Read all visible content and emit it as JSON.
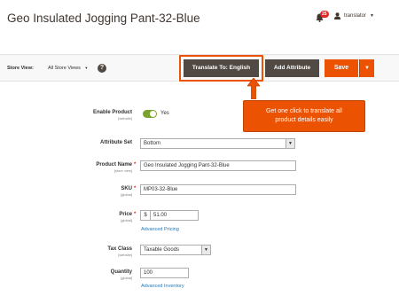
{
  "header": {
    "title": "Geo Insulated Jogging Pant-32-Blue",
    "notification_count": "25",
    "user_name": "translator",
    "icons": [
      "bell-icon",
      "user-icon",
      "caret-down-icon"
    ]
  },
  "action_bar": {
    "store_view_label": "Store View:",
    "store_view_value": "All Store Views",
    "help_label": "?",
    "translate_label": "Translate To: English",
    "add_attribute_label": "Add Attribute",
    "save_label": "Save",
    "save_split_label": "▼"
  },
  "callout": {
    "line1": "Get one click to translate all",
    "line2": "product details easily"
  },
  "form": {
    "enable_product": {
      "label": "Enable Product",
      "scope": "[website]",
      "value": "Yes",
      "checked": true
    },
    "attribute_set": {
      "label": "Attribute Set",
      "value": "Bottom"
    },
    "product_name": {
      "label": "Product Name",
      "scope": "[store view]",
      "value": "Geo Insulated Jogging Pant-32-Blue"
    },
    "sku": {
      "label": "SKU",
      "scope": "[global]",
      "value": "MP03-32-Blue"
    },
    "price": {
      "label": "Price",
      "scope": "[global]",
      "currency": "$",
      "value": "51.00",
      "link": "Advanced Pricing"
    },
    "tax_class": {
      "label": "Tax Class",
      "scope": "[website]",
      "value": "Taxable Goods"
    },
    "quantity": {
      "label": "Quantity",
      "scope": "[global]",
      "value": "100",
      "link": "Advanced Inventory"
    }
  },
  "colors": {
    "accent": "#eb5202",
    "dark_button": "#514943",
    "toggle_on": "#79a22e",
    "link": "#1979c3",
    "required": "#e22626"
  }
}
